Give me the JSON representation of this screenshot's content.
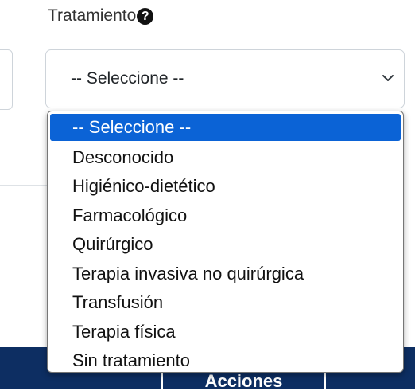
{
  "field": {
    "label": "Tratamiento",
    "help_glyph": "?"
  },
  "select": {
    "value": "-- Seleccione --"
  },
  "dropdown": {
    "options": [
      "-- Seleccione --",
      "Desconocido",
      "Higiénico-dietético",
      "Farmacológico",
      "Quirúrgico",
      "Terapia invasiva no quirúrgica",
      "Transfusión",
      "Terapia física",
      "Sin tratamiento"
    ],
    "selected_index": 0
  },
  "table": {
    "header_actions": "Acciones"
  },
  "colors": {
    "highlight": "#0b63d6",
    "table_header_bg": "#0d2e62"
  },
  "icons": {
    "help": "question-circle-icon",
    "select_arrow": "chevron-down-icon"
  }
}
